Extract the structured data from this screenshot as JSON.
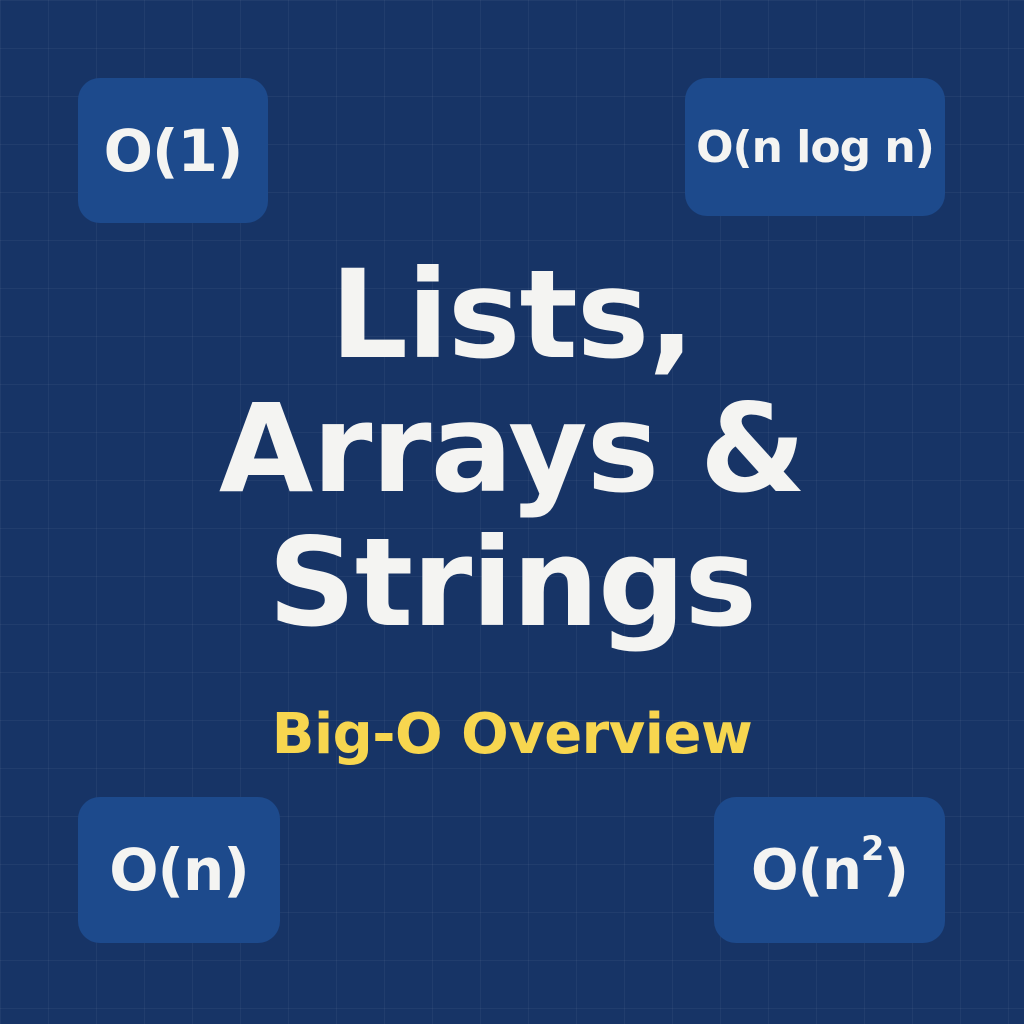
{
  "badges": {
    "top_left": "O(1)",
    "top_right": "O(n log n)",
    "bottom_left": "O(n)",
    "bottom_right": {
      "base": "O(n",
      "superscript": "2",
      "close": ")"
    }
  },
  "title": {
    "lines": [
      "Lists,",
      "Arrays &",
      "Strings"
    ]
  },
  "subtitle": "Big-O Overview",
  "colors": {
    "background": "#173466",
    "badge": "#1d4a8c",
    "title_text": "#f4f4f2",
    "subtitle_text": "#f7d64f"
  }
}
